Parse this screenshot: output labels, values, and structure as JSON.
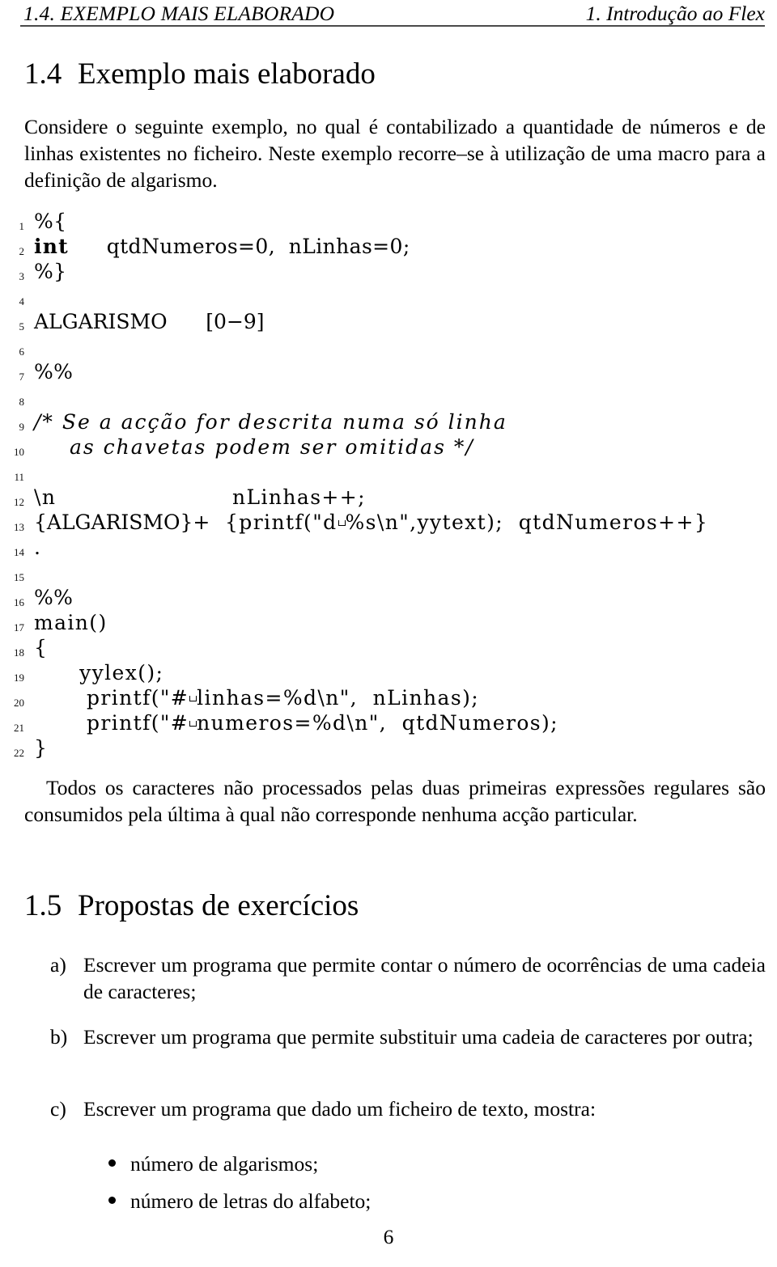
{
  "header": {
    "left": "1.4. EXEMPLO MAIS ELABORADO",
    "right": "1. Introdução ao Flex"
  },
  "sections": [
    {
      "number": "1.4",
      "title": "Exemplo mais elaborado"
    },
    {
      "number": "1.5",
      "title": "Propostas de exercícios"
    }
  ],
  "paragraphs": {
    "intro": "Considere o seguinte exemplo, no qual é contabilizado a quantidade de números e de linhas existentes no ficheiro. Neste exemplo recorre–se à utilização de uma macro para a definição de algarismo.",
    "after_code": "Todos os caracteres não processados pelas duas primeiras expressões regulares são consumidos pela última à qual não corresponde nenhuma acção particular."
  },
  "listing": {
    "lines": [
      {
        "n": "1",
        "text": "%{"
      },
      {
        "n": "2",
        "text": "int  qtdNumeros=0,  nLinhas=0;"
      },
      {
        "n": "3",
        "text": "%}"
      },
      {
        "n": "4",
        "text": ""
      },
      {
        "n": "5",
        "text": "ALGARISMO      [0−9]"
      },
      {
        "n": "6",
        "text": ""
      },
      {
        "n": "7",
        "text": "%%"
      },
      {
        "n": "8",
        "text": ""
      },
      {
        "n": "9",
        "text": "/* Se a acção for descrita numa só linha"
      },
      {
        "n": "10",
        "text": "    as chavetas podem ser omitidas */"
      },
      {
        "n": "11",
        "text": ""
      },
      {
        "n": "12",
        "text": "\\n                nLinhas++;"
      },
      {
        "n": "13",
        "text": "{ALGARISMO}+      {printf(\"d %s\\n\",yytext);  qtdNumeros++}"
      },
      {
        "n": "14",
        "text": "."
      },
      {
        "n": "15",
        "text": ""
      },
      {
        "n": "16",
        "text": "%%"
      },
      {
        "n": "17",
        "text": "main()"
      },
      {
        "n": "18",
        "text": "{"
      },
      {
        "n": "19",
        "text": "      yylex();"
      },
      {
        "n": "20",
        "text": "      printf(\"# linhas=%d\\n\",  nLinhas);"
      },
      {
        "n": "21",
        "text": "      printf(\"# numeros=%d\\n\",  qtdNumeros);"
      },
      {
        "n": "22",
        "text": "}"
      }
    ],
    "line_2_keyword": "int",
    "line_2_rest": "  qtdNumeros=0,  nLinhas=0;",
    "line_9_comment": "/* Se a acção for descrita numa só linha",
    "line_10_comment": "as chavetas podem ser omitidas */",
    "line_12_pattern": "\\n",
    "line_12_action": "nLinhas++;",
    "line_13_pattern": "{ALGARISMO}+",
    "line_13_action_pre": "{printf(\"d",
    "line_13_action_post": "%s\\n\",yytext);  qtdNumeros++}",
    "line_20_pre": "printf(\"#",
    "line_20_post": "linhas=%d\\n\",  nLinhas);",
    "line_21_pre": "printf(\"#",
    "line_21_post": "numeros=%d\\n\",  qtdNumeros);"
  },
  "exercises": [
    {
      "marker": "a)",
      "text": "Escrever um programa que permite contar o número de ocorrências de uma cadeia de caracteres;"
    },
    {
      "marker": "b)",
      "text": "Escrever um programa que permite substituir uma cadeia de caracteres por outra;"
    },
    {
      "marker": "c)",
      "text": "Escrever um programa que dado um ficheiro de texto, mostra:"
    }
  ],
  "bullets": [
    "número de algarismos;",
    "número de letras do alfabeto;"
  ],
  "page_number": "6"
}
